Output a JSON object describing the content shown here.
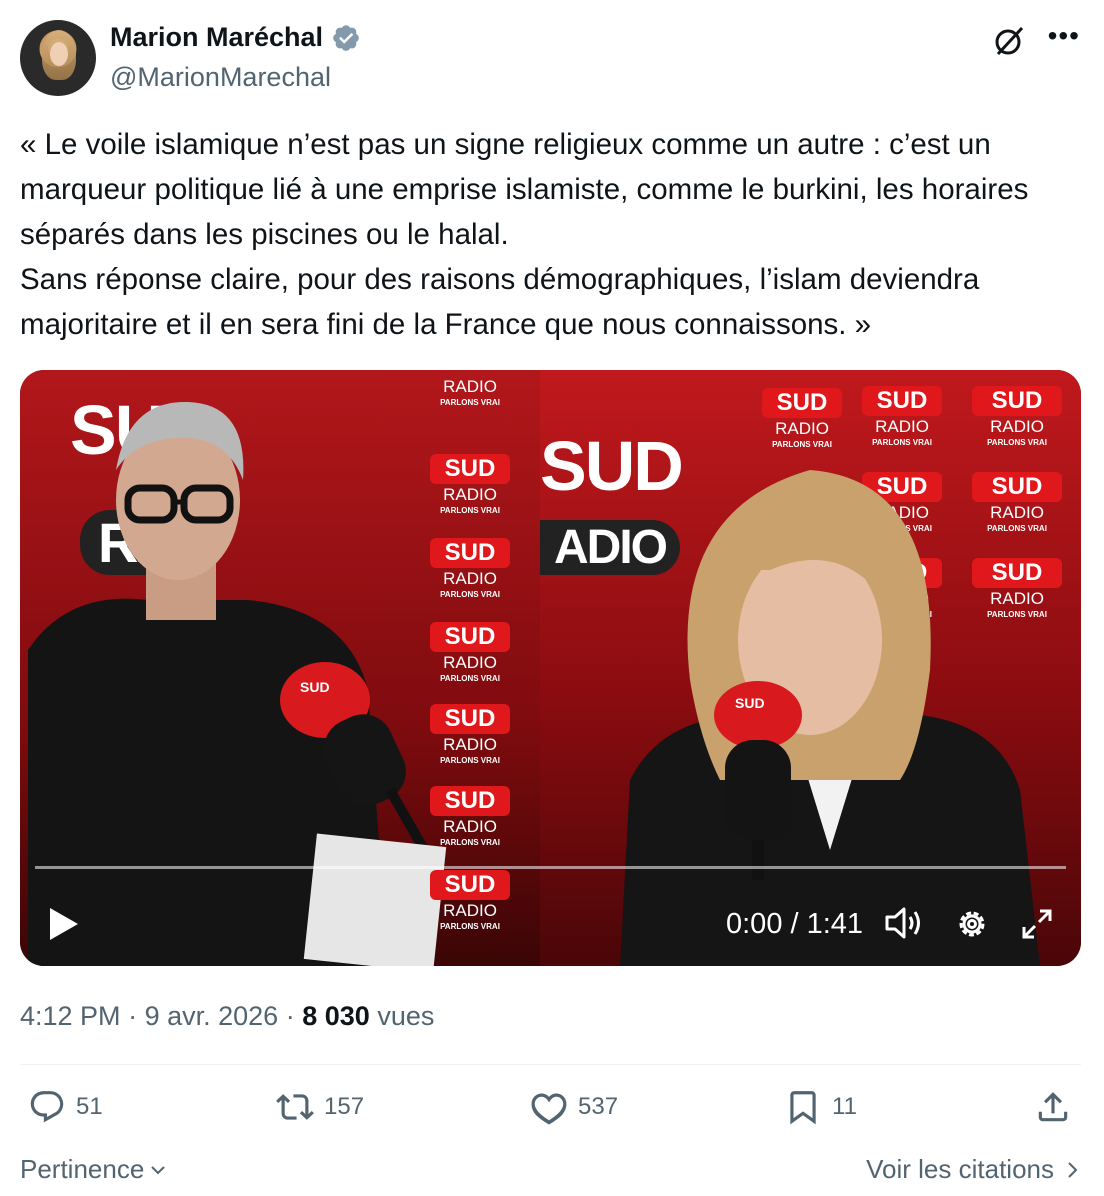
{
  "author": {
    "name": "Marion Maréchal",
    "handle": "@MarionMarechal",
    "verified": true
  },
  "icons": {
    "grok": "grok-icon",
    "more": "more-icon"
  },
  "tweet_text": "« Le voile islamique n’est pas un signe religieux comme un autre : c’est un marqueur politique lié à une emprise islamiste, comme le burkini, les horaires séparés dans les piscines ou le halal.\nSans réponse claire, pour des raisons démographiques, l’islam deviendra majoritaire et il en sera fini de la France que nous connaissons. »",
  "video": {
    "time": "0:00 / 1:41",
    "progress": 0,
    "wall_sud": "SUD",
    "wall_radio": "RADIO",
    "wall_tagline": "PARLONS VRAI",
    "big_left": "SU",
    "big_left_sub": "RA",
    "big_right": "SUD",
    "big_right_sub": "ADIO"
  },
  "meta": {
    "time": "4:12 PM",
    "separator": "·",
    "date": "9 avr. 2026",
    "views_count": "8 030",
    "views_label": "vues"
  },
  "actions": {
    "replies": "51",
    "reposts": "157",
    "likes": "537",
    "bookmarks": "11"
  },
  "footer": {
    "sort_label": "Pertinence",
    "quotes_label": "Voir les citations"
  },
  "colors": {
    "text": "#0f1419",
    "muted": "#536471",
    "verified": "#829aab",
    "video_red": "#b2171b"
  }
}
